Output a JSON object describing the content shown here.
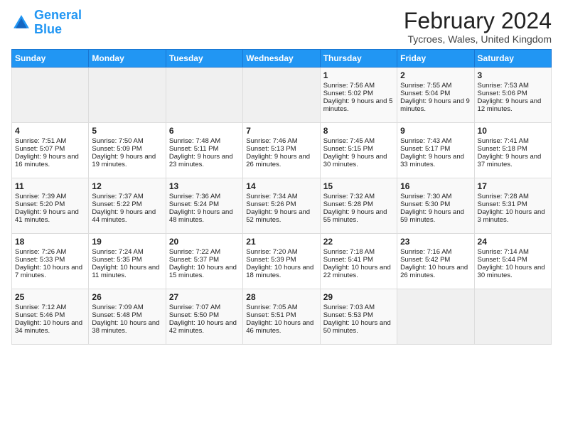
{
  "header": {
    "logo_line1": "General",
    "logo_line2": "Blue",
    "main_title": "February 2024",
    "subtitle": "Tycroes, Wales, United Kingdom"
  },
  "days_of_week": [
    "Sunday",
    "Monday",
    "Tuesday",
    "Wednesday",
    "Thursday",
    "Friday",
    "Saturday"
  ],
  "weeks": [
    [
      {
        "day": "",
        "empty": true
      },
      {
        "day": "",
        "empty": true
      },
      {
        "day": "",
        "empty": true
      },
      {
        "day": "",
        "empty": true
      },
      {
        "day": "1",
        "sunrise": "Sunrise: 7:56 AM",
        "sunset": "Sunset: 5:02 PM",
        "daylight": "Daylight: 9 hours and 5 minutes."
      },
      {
        "day": "2",
        "sunrise": "Sunrise: 7:55 AM",
        "sunset": "Sunset: 5:04 PM",
        "daylight": "Daylight: 9 hours and 9 minutes."
      },
      {
        "day": "3",
        "sunrise": "Sunrise: 7:53 AM",
        "sunset": "Sunset: 5:06 PM",
        "daylight": "Daylight: 9 hours and 12 minutes."
      }
    ],
    [
      {
        "day": "4",
        "sunrise": "Sunrise: 7:51 AM",
        "sunset": "Sunset: 5:07 PM",
        "daylight": "Daylight: 9 hours and 16 minutes."
      },
      {
        "day": "5",
        "sunrise": "Sunrise: 7:50 AM",
        "sunset": "Sunset: 5:09 PM",
        "daylight": "Daylight: 9 hours and 19 minutes."
      },
      {
        "day": "6",
        "sunrise": "Sunrise: 7:48 AM",
        "sunset": "Sunset: 5:11 PM",
        "daylight": "Daylight: 9 hours and 23 minutes."
      },
      {
        "day": "7",
        "sunrise": "Sunrise: 7:46 AM",
        "sunset": "Sunset: 5:13 PM",
        "daylight": "Daylight: 9 hours and 26 minutes."
      },
      {
        "day": "8",
        "sunrise": "Sunrise: 7:45 AM",
        "sunset": "Sunset: 5:15 PM",
        "daylight": "Daylight: 9 hours and 30 minutes."
      },
      {
        "day": "9",
        "sunrise": "Sunrise: 7:43 AM",
        "sunset": "Sunset: 5:17 PM",
        "daylight": "Daylight: 9 hours and 33 minutes."
      },
      {
        "day": "10",
        "sunrise": "Sunrise: 7:41 AM",
        "sunset": "Sunset: 5:18 PM",
        "daylight": "Daylight: 9 hours and 37 minutes."
      }
    ],
    [
      {
        "day": "11",
        "sunrise": "Sunrise: 7:39 AM",
        "sunset": "Sunset: 5:20 PM",
        "daylight": "Daylight: 9 hours and 41 minutes."
      },
      {
        "day": "12",
        "sunrise": "Sunrise: 7:37 AM",
        "sunset": "Sunset: 5:22 PM",
        "daylight": "Daylight: 9 hours and 44 minutes."
      },
      {
        "day": "13",
        "sunrise": "Sunrise: 7:36 AM",
        "sunset": "Sunset: 5:24 PM",
        "daylight": "Daylight: 9 hours and 48 minutes."
      },
      {
        "day": "14",
        "sunrise": "Sunrise: 7:34 AM",
        "sunset": "Sunset: 5:26 PM",
        "daylight": "Daylight: 9 hours and 52 minutes."
      },
      {
        "day": "15",
        "sunrise": "Sunrise: 7:32 AM",
        "sunset": "Sunset: 5:28 PM",
        "daylight": "Daylight: 9 hours and 55 minutes."
      },
      {
        "day": "16",
        "sunrise": "Sunrise: 7:30 AM",
        "sunset": "Sunset: 5:30 PM",
        "daylight": "Daylight: 9 hours and 59 minutes."
      },
      {
        "day": "17",
        "sunrise": "Sunrise: 7:28 AM",
        "sunset": "Sunset: 5:31 PM",
        "daylight": "Daylight: 10 hours and 3 minutes."
      }
    ],
    [
      {
        "day": "18",
        "sunrise": "Sunrise: 7:26 AM",
        "sunset": "Sunset: 5:33 PM",
        "daylight": "Daylight: 10 hours and 7 minutes."
      },
      {
        "day": "19",
        "sunrise": "Sunrise: 7:24 AM",
        "sunset": "Sunset: 5:35 PM",
        "daylight": "Daylight: 10 hours and 11 minutes."
      },
      {
        "day": "20",
        "sunrise": "Sunrise: 7:22 AM",
        "sunset": "Sunset: 5:37 PM",
        "daylight": "Daylight: 10 hours and 15 minutes."
      },
      {
        "day": "21",
        "sunrise": "Sunrise: 7:20 AM",
        "sunset": "Sunset: 5:39 PM",
        "daylight": "Daylight: 10 hours and 18 minutes."
      },
      {
        "day": "22",
        "sunrise": "Sunrise: 7:18 AM",
        "sunset": "Sunset: 5:41 PM",
        "daylight": "Daylight: 10 hours and 22 minutes."
      },
      {
        "day": "23",
        "sunrise": "Sunrise: 7:16 AM",
        "sunset": "Sunset: 5:42 PM",
        "daylight": "Daylight: 10 hours and 26 minutes."
      },
      {
        "day": "24",
        "sunrise": "Sunrise: 7:14 AM",
        "sunset": "Sunset: 5:44 PM",
        "daylight": "Daylight: 10 hours and 30 minutes."
      }
    ],
    [
      {
        "day": "25",
        "sunrise": "Sunrise: 7:12 AM",
        "sunset": "Sunset: 5:46 PM",
        "daylight": "Daylight: 10 hours and 34 minutes."
      },
      {
        "day": "26",
        "sunrise": "Sunrise: 7:09 AM",
        "sunset": "Sunset: 5:48 PM",
        "daylight": "Daylight: 10 hours and 38 minutes."
      },
      {
        "day": "27",
        "sunrise": "Sunrise: 7:07 AM",
        "sunset": "Sunset: 5:50 PM",
        "daylight": "Daylight: 10 hours and 42 minutes."
      },
      {
        "day": "28",
        "sunrise": "Sunrise: 7:05 AM",
        "sunset": "Sunset: 5:51 PM",
        "daylight": "Daylight: 10 hours and 46 minutes."
      },
      {
        "day": "29",
        "sunrise": "Sunrise: 7:03 AM",
        "sunset": "Sunset: 5:53 PM",
        "daylight": "Daylight: 10 hours and 50 minutes."
      },
      {
        "day": "",
        "empty": true
      },
      {
        "day": "",
        "empty": true
      }
    ]
  ]
}
